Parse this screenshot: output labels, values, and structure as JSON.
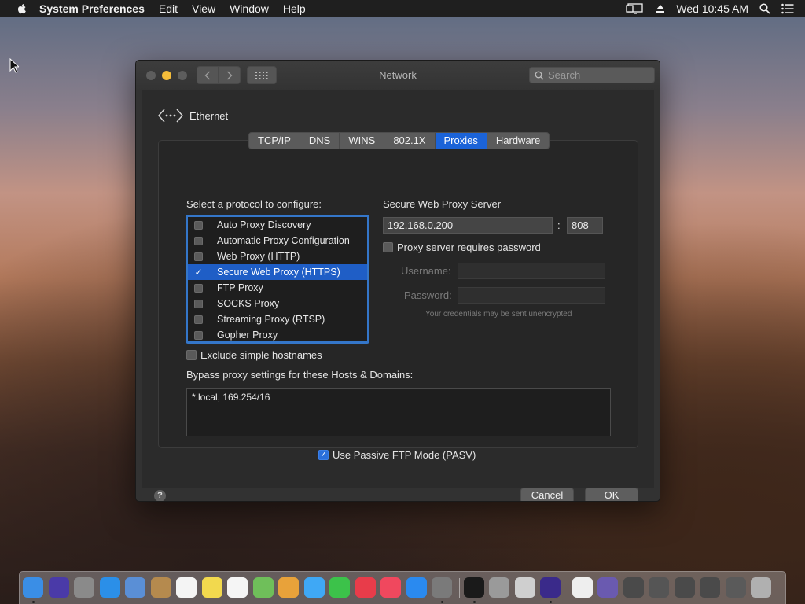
{
  "menubar": {
    "app_name": "System Preferences",
    "items": [
      "Edit",
      "View",
      "Window",
      "Help"
    ],
    "clock": "Wed 10:45 AM"
  },
  "window": {
    "title": "Network",
    "search_placeholder": "Search",
    "interface_name": "Ethernet",
    "tabs": [
      "TCP/IP",
      "DNS",
      "WINS",
      "802.1X",
      "Proxies",
      "Hardware"
    ],
    "active_tab": "Proxies"
  },
  "proxies": {
    "select_label": "Select a protocol to configure:",
    "protocols": [
      {
        "label": "Auto Proxy Discovery",
        "checked": false
      },
      {
        "label": "Automatic Proxy Configuration",
        "checked": false
      },
      {
        "label": "Web Proxy (HTTP)",
        "checked": false
      },
      {
        "label": "Secure Web Proxy (HTTPS)",
        "checked": true,
        "selected": true
      },
      {
        "label": "FTP Proxy",
        "checked": false
      },
      {
        "label": "SOCKS Proxy",
        "checked": false
      },
      {
        "label": "Streaming Proxy (RTSP)",
        "checked": false
      },
      {
        "label": "Gopher Proxy",
        "checked": false
      }
    ],
    "server_label": "Secure Web Proxy Server",
    "server_address": "192.168.0.200",
    "colon": ":",
    "server_port": "808",
    "password_label": "Proxy server requires password",
    "password_required": false,
    "username_label": "Username:",
    "password_field_label": "Password:",
    "credentials_note": "Your credentials may be sent unencrypted",
    "exclude_label": "Exclude simple hostnames",
    "exclude_checked": false,
    "bypass_label": "Bypass proxy settings for these Hosts & Domains:",
    "bypass_value": "*.local, 169.254/16",
    "pasv_label": "Use Passive FTP Mode (PASV)",
    "pasv_checked": true
  },
  "buttons": {
    "help": "?",
    "cancel": "Cancel",
    "ok": "OK"
  },
  "colors": {
    "accent": "#1f5ec6",
    "window_bg": "#323232",
    "minimize_button": "#f5bd3a"
  },
  "dock": {
    "apps": [
      {
        "name": "finder-icon",
        "color": "#3a8ee6"
      },
      {
        "name": "siri-icon",
        "color": "#4a3aa8"
      },
      {
        "name": "launchpad-icon",
        "color": "#8a8a8a"
      },
      {
        "name": "safari-icon",
        "color": "#2b8fe8"
      },
      {
        "name": "mail-icon",
        "color": "#5a8fd6"
      },
      {
        "name": "contacts-icon",
        "color": "#b58a4e"
      },
      {
        "name": "calendar-icon",
        "color": "#f4f4f4"
      },
      {
        "name": "notes-icon",
        "color": "#f2d94e"
      },
      {
        "name": "reminders-icon",
        "color": "#f5f5f5"
      },
      {
        "name": "maps-icon",
        "color": "#6fbf5a"
      },
      {
        "name": "photos-icon",
        "color": "#e8a23a"
      },
      {
        "name": "messages-icon",
        "color": "#3fa8f5"
      },
      {
        "name": "facetime-icon",
        "color": "#3cc24a"
      },
      {
        "name": "news-icon",
        "color": "#e83c4a"
      },
      {
        "name": "music-icon",
        "color": "#f0485e"
      },
      {
        "name": "app-store-icon",
        "color": "#2a8af0"
      },
      {
        "name": "system-preferences-icon",
        "color": "#7a7a7a"
      },
      {
        "name": "terminal-icon",
        "color": "#1a1a1a"
      },
      {
        "name": "keychain-icon",
        "color": "#9a9a9a"
      },
      {
        "name": "font-book-icon",
        "color": "#cfcfcf"
      },
      {
        "name": "time-machine-icon",
        "color": "#3a2a8a"
      },
      {
        "name": "document-icon",
        "color": "#eeeeee"
      },
      {
        "name": "screenshot-icon",
        "color": "#6a5ab0"
      },
      {
        "name": "window-thumbnail-icon",
        "color": "#4a4a4a"
      },
      {
        "name": "window-thumbnail-icon",
        "color": "#555555"
      },
      {
        "name": "window-thumbnail-icon",
        "color": "#4a4a4a"
      },
      {
        "name": "window-thumbnail-icon",
        "color": "#4a4a4a"
      },
      {
        "name": "window-thumbnail-icon",
        "color": "#5a5a5a"
      },
      {
        "name": "trash-icon",
        "color": "#b0b0b0"
      }
    ]
  }
}
